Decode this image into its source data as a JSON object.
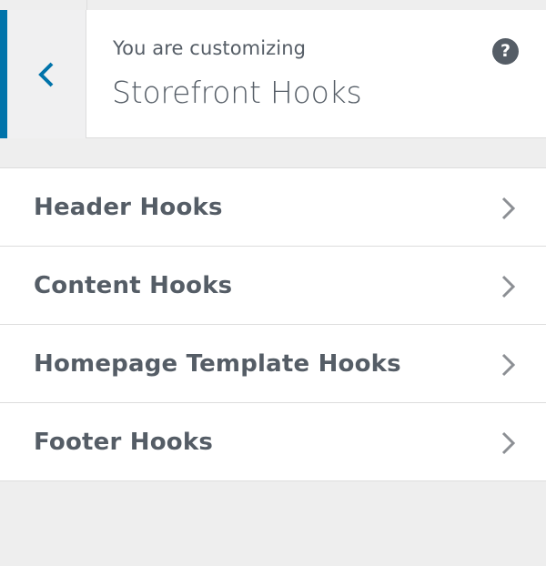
{
  "header": {
    "customizing_label": "You are customizing",
    "panel_title": "Storefront Hooks",
    "help_symbol": "?",
    "back_icon": "chevron-left-icon",
    "help_icon": "help-icon"
  },
  "sections": [
    {
      "label": "Header Hooks",
      "icon": "chevron-right-icon"
    },
    {
      "label": "Content Hooks",
      "icon": "chevron-right-icon"
    },
    {
      "label": "Homepage Template Hooks",
      "icon": "chevron-right-icon"
    },
    {
      "label": "Footer Hooks",
      "icon": "chevron-right-icon"
    }
  ],
  "colors": {
    "accent": "#0073aa",
    "text": "#555d66",
    "chevron": "#8c8f94",
    "background": "#eeeeee",
    "border": "#dddddd"
  }
}
